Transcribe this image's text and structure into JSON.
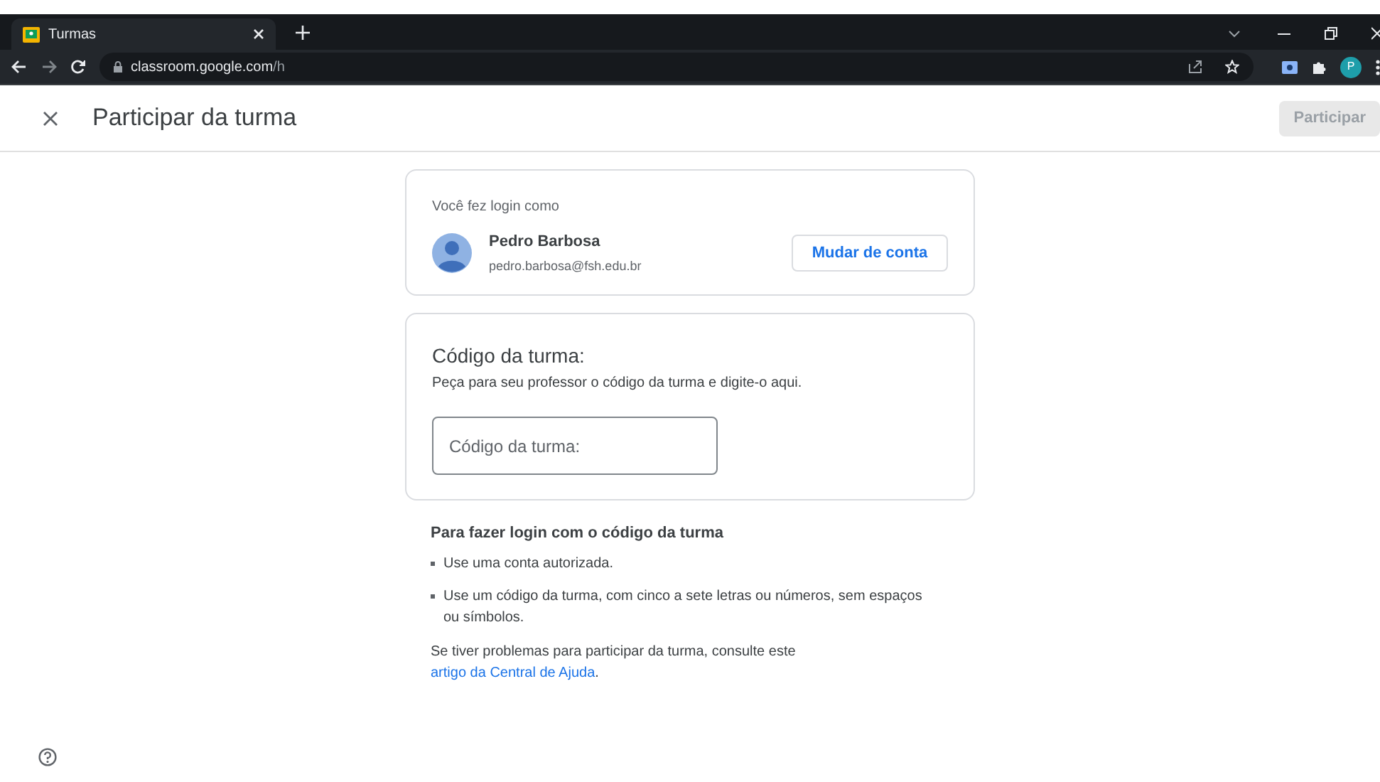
{
  "browser": {
    "tab_title": "Turmas",
    "url_host": "classroom.google.com",
    "url_path": "/h",
    "profile_initial": "P"
  },
  "header": {
    "title": "Participar da turma",
    "join_button": {
      "label": "Participar",
      "disabled": true
    }
  },
  "account_card": {
    "caption": "Você fez login como",
    "name": "Pedro Barbosa",
    "email": "pedro.barbosa@fsh.edu.br",
    "switch_button": "Mudar de conta"
  },
  "code_card": {
    "title": "Código da turma:",
    "subtitle": "Peça para seu professor o código da turma e digite-o aqui.",
    "field": {
      "placeholder": "Código da turma:"
    }
  },
  "instructions": {
    "heading": "Para fazer login com o código da turma",
    "bullets": [
      "Use uma conta autorizada.",
      "Use um código da turma, com cinco a sete letras ou números, sem espaços ou símbolos."
    ],
    "help_text": "Se tiver problemas para participar da turma, consulte este",
    "help_link": "artigo da Central de Ajuda",
    "help_end": "."
  }
}
